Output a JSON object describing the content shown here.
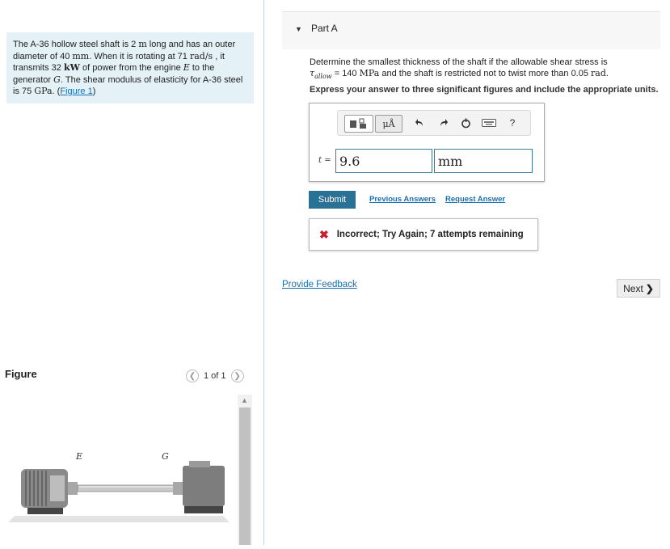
{
  "problem": {
    "text_1": "The A-36 hollow steel shaft is 2 ",
    "unit_m": "m",
    "text_2": " long and has an outer diameter of 40 ",
    "unit_mm": "mm",
    "text_3": ". When it is rotating at 71 ",
    "unit_rads": "rad/s",
    "text_4": " , it transmits 32 ",
    "unit_kw": "kW",
    "text_5": " of power from the engine ",
    "var_e": "E",
    "text_6": " to the generator ",
    "var_g": "G",
    "text_7": ". The shear modulus of elasticity for A-36 steel is 75 ",
    "unit_gpa": "GPa",
    "text_8": ". (",
    "figure_link": "Figure 1",
    "text_9": ")"
  },
  "figure": {
    "label": "Figure",
    "pager_text": "1 of 1",
    "engine_label": "E",
    "generator_label": "G"
  },
  "part": {
    "title": "Part A",
    "question_1": "Determine the smallest thickness of the shaft if the allowable shear stress is",
    "tau": "τ",
    "tau_sub": "allow",
    "question_2": " = 140 ",
    "unit_mpa": "MPa",
    "question_3": " and the shaft is restricted not to twist more than 0.05 ",
    "unit_rad": "rad",
    "question_4": ".",
    "instruction": "Express your answer to three significant figures and include the appropriate units."
  },
  "answer": {
    "var_label": "t =",
    "value": "9.6",
    "units": "mm",
    "units_button": "μÅ",
    "help_label": "?"
  },
  "actions": {
    "submit_label": "Submit",
    "previous_answers": "Previous Answers",
    "request_answer": "Request Answer"
  },
  "feedback": {
    "message": "Incorrect; Try Again; 7 attempts remaining"
  },
  "footer": {
    "provide_feedback": "Provide Feedback",
    "next_label": "Next"
  },
  "colors": {
    "accent": "#2a7196",
    "link": "#1a6fb0",
    "error": "#c8202f",
    "problem_bg": "#e4f1f7"
  }
}
